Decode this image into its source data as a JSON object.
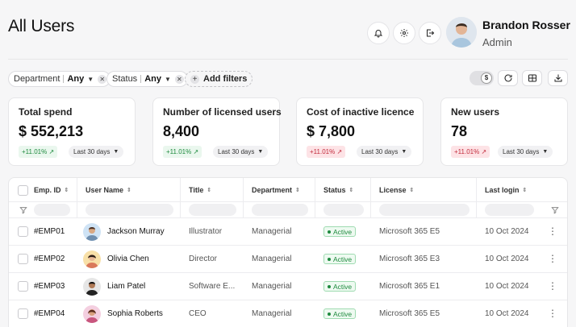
{
  "header": {
    "title": "All Users",
    "user": {
      "name": "Brandon Rosser",
      "role": "Admin"
    }
  },
  "filters": [
    {
      "label": "Department",
      "value": "Any"
    },
    {
      "label": "Status",
      "value": "Any"
    }
  ],
  "add_filters_label": "Add filters",
  "toolbar": {
    "toggle_symbol": "$"
  },
  "cards": [
    {
      "label": "Total spend",
      "value": "$ 552,213",
      "change": "+11.01%",
      "trend": "up",
      "period": "Last 30 days"
    },
    {
      "label": "Number of licensed users",
      "value": "8,400",
      "change": "+11.01%",
      "trend": "up",
      "period": "Last 30 days"
    },
    {
      "label": "Cost of inactive licence",
      "value": "$ 7,800",
      "change": "+11.01%",
      "trend": "down",
      "period": "Last 30 days"
    },
    {
      "label": "New users",
      "value": "78",
      "change": "+11.01%",
      "trend": "down",
      "period": "Last 30 days"
    }
  ],
  "table": {
    "columns": [
      "Emp. ID",
      "User Name",
      "Title",
      "Department",
      "Status",
      "License",
      "Last login"
    ],
    "rows": [
      {
        "id": "#EMP01",
        "name": "Jackson Murray",
        "title": "Illustrator",
        "department": "Managerial",
        "status": "Active",
        "license": "Microsoft 365 E5",
        "last_login": "10 Oct 2024",
        "avatar_bg": "#cfe3f5"
      },
      {
        "id": "#EMP02",
        "name": "Olivia Chen",
        "title": "Director",
        "department": "Managerial",
        "status": "Active",
        "license": "Microsoft 365 E3",
        "last_login": "10 Oct 2024",
        "avatar_bg": "#f8e0a8"
      },
      {
        "id": "#EMP03",
        "name": "Liam Patel",
        "title": "Software E...",
        "department": "Managerial",
        "status": "Active",
        "license": "Microsoft 365 E1",
        "last_login": "10 Oct 2024",
        "avatar_bg": "#e6e6e6"
      },
      {
        "id": "#EMP04",
        "name": "Sophia Roberts",
        "title": "CEO",
        "department": "Managerial",
        "status": "Active",
        "license": "Microsoft 365 E5",
        "last_login": "10 Oct 2024",
        "avatar_bg": "#f4cfe0"
      }
    ]
  },
  "colors": {
    "accent_up": "#1e8a3e",
    "accent_down": "#c22b3c",
    "status_active": "#1e8a3e"
  }
}
